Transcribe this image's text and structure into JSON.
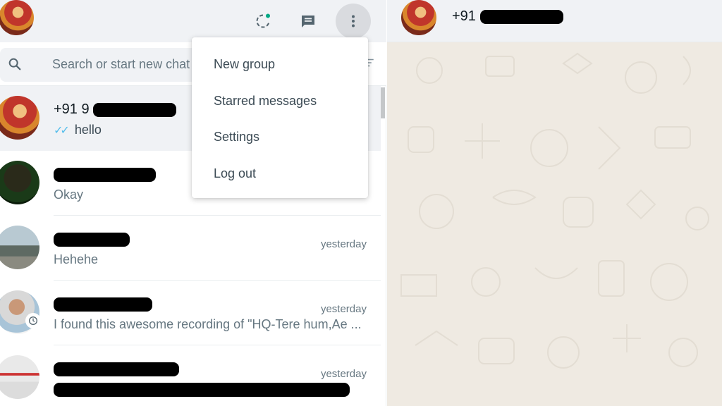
{
  "header": {
    "my_avatar": "profile-avatar",
    "icons": [
      "status-icon",
      "new-chat-icon",
      "menu-dots-icon"
    ]
  },
  "search": {
    "placeholder": "Search or start new chat",
    "icon": "search-icon",
    "filter_icon": "filter-icon"
  },
  "menu": {
    "items": [
      {
        "label": "New group"
      },
      {
        "label": "Starred messages"
      },
      {
        "label": "Settings"
      },
      {
        "label": "Log out"
      }
    ]
  },
  "chats": [
    {
      "name_prefix": "+91 9",
      "message": "hello",
      "time": "",
      "read_ticks": true
    },
    {
      "name_prefix": "",
      "message": "Okay",
      "time": ""
    },
    {
      "name_prefix": "",
      "message": "Hehehe",
      "time": "yesterday"
    },
    {
      "name_prefix": "",
      "message": "I found this awesome recording of \"HQ-Tere hum,Ae ...",
      "time": "yesterday"
    },
    {
      "name_prefix": "",
      "message": "",
      "time": "yesterday"
    }
  ],
  "conversation": {
    "contact_name_prefix": "+91"
  },
  "colors": {
    "panel_bg": "#f0f2f5",
    "chat_bg": "#efeae2",
    "read_tick": "#53bdeb",
    "status_dot": "#00a884"
  }
}
